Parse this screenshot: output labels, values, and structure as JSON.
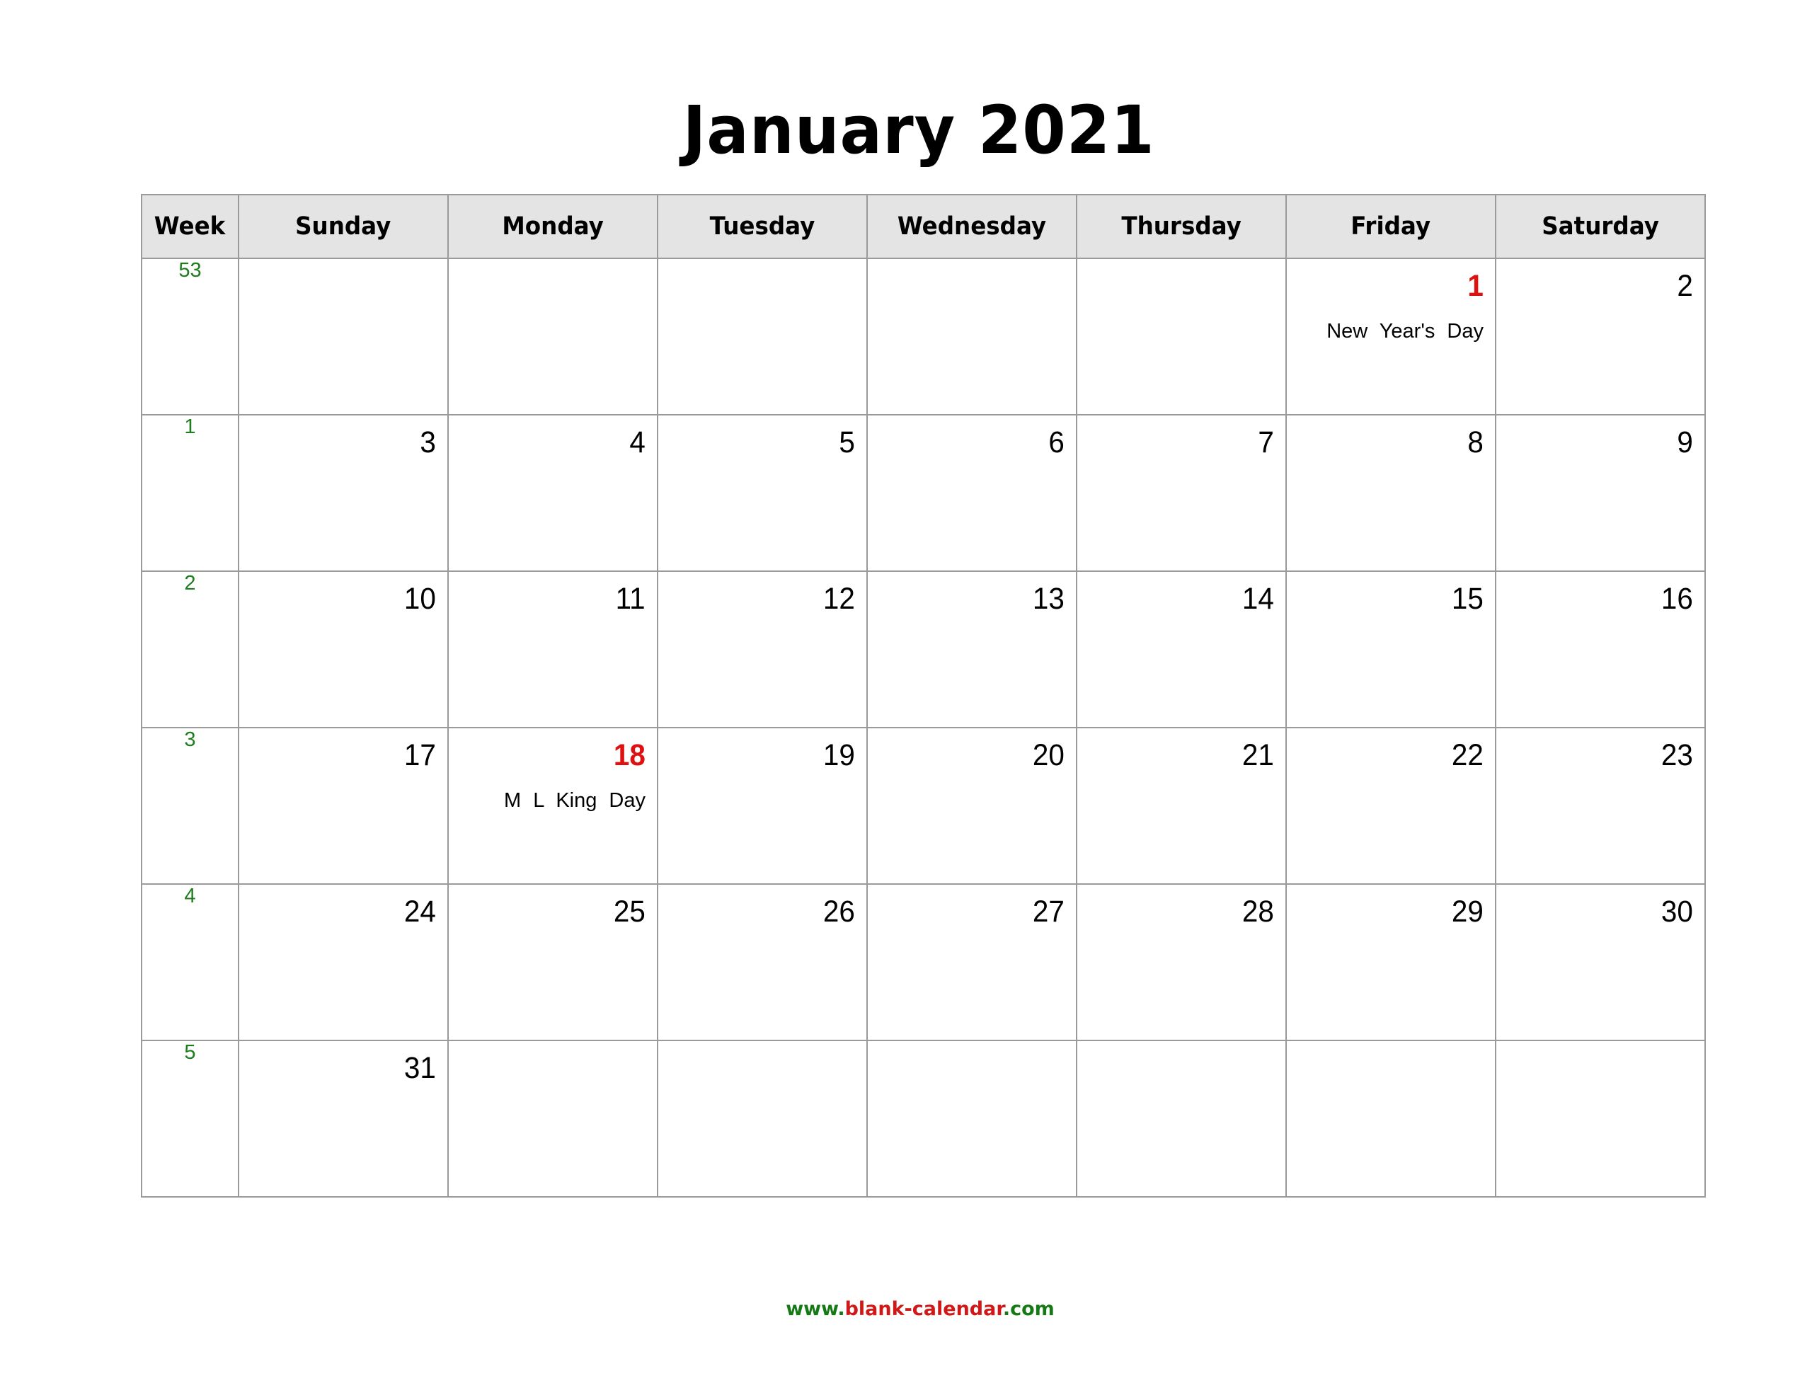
{
  "title": "January 2021",
  "header": {
    "week_label": "Week",
    "days": [
      "Sunday",
      "Monday",
      "Tuesday",
      "Wednesday",
      "Thursday",
      "Friday",
      "Saturday"
    ]
  },
  "colors": {
    "holiday": "#dd1111",
    "week_number": "#1e7d1e",
    "header_bg": "#e4e4e4",
    "grid": "#9a9a9a",
    "footer_green": "#157a15",
    "footer_red": "#d01818"
  },
  "weeks": [
    {
      "week": "53",
      "days": [
        {
          "d": ""
        },
        {
          "d": ""
        },
        {
          "d": ""
        },
        {
          "d": ""
        },
        {
          "d": ""
        },
        {
          "d": "1",
          "holiday": "New Year's Day"
        },
        {
          "d": "2"
        }
      ]
    },
    {
      "week": "1",
      "days": [
        {
          "d": "3"
        },
        {
          "d": "4"
        },
        {
          "d": "5"
        },
        {
          "d": "6"
        },
        {
          "d": "7"
        },
        {
          "d": "8"
        },
        {
          "d": "9"
        }
      ]
    },
    {
      "week": "2",
      "days": [
        {
          "d": "10"
        },
        {
          "d": "11"
        },
        {
          "d": "12"
        },
        {
          "d": "13"
        },
        {
          "d": "14"
        },
        {
          "d": "15"
        },
        {
          "d": "16"
        }
      ]
    },
    {
      "week": "3",
      "days": [
        {
          "d": "17"
        },
        {
          "d": "18",
          "holiday": "M L King Day"
        },
        {
          "d": "19"
        },
        {
          "d": "20"
        },
        {
          "d": "21"
        },
        {
          "d": "22"
        },
        {
          "d": "23"
        }
      ]
    },
    {
      "week": "4",
      "days": [
        {
          "d": "24"
        },
        {
          "d": "25"
        },
        {
          "d": "26"
        },
        {
          "d": "27"
        },
        {
          "d": "28"
        },
        {
          "d": "29"
        },
        {
          "d": "30"
        }
      ]
    },
    {
      "week": "5",
      "days": [
        {
          "d": "31"
        },
        {
          "d": ""
        },
        {
          "d": ""
        },
        {
          "d": ""
        },
        {
          "d": ""
        },
        {
          "d": ""
        },
        {
          "d": ""
        }
      ]
    }
  ],
  "footer": {
    "prefix": "www.",
    "name": "blank-calendar",
    "suffix": ".com"
  }
}
